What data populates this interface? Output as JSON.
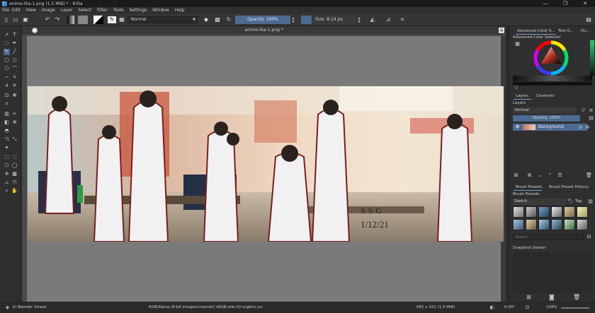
{
  "window": {
    "title": "anime-tka-1.png (1.5 MiB)  * - Krita",
    "minimize": "—",
    "maximize": "❐",
    "close": "✕"
  },
  "menu": [
    "File",
    "Edit",
    "View",
    "Image",
    "Layer",
    "Select",
    "Filter",
    "Tools",
    "Settings",
    "Window",
    "Help"
  ],
  "toolbar": {
    "blend_mode": "Normal",
    "opacity": "Opacity: 100%",
    "size": "Size: 8.14 px"
  },
  "document": {
    "tab_title": "anime-tka-1.png *",
    "signature": "S·S·G",
    "signature_date": "1/12/21"
  },
  "dockers": {
    "top_tabs": [
      "Advanced Color S...",
      "Tool O...",
      "Ov..."
    ],
    "color_selector_title": "Advanced Color Selector",
    "layers_tabs": [
      "Layers",
      "Channels"
    ],
    "layers_section": "Layers",
    "layer_blend": "Normal",
    "layer_opacity": "Opacity: 100%",
    "layer_name": "Background",
    "brush_tabs": [
      "Brush Presets",
      "Brush Preset History"
    ],
    "brush_presets_title": "Brush Presets",
    "brush_tag": "Sketch",
    "tag_label": "Tag",
    "search_placeholder": "Search",
    "snapshot_title": "Snapshot Docker"
  },
  "status": {
    "brush": "k) Blender Smear",
    "color_info": "RGB/Alpha (8-bit integer/channel)  sRGB-elle-V2-srgbtrc.icc",
    "dimensions": "681 x 321 (1.5 MiB)",
    "rotation": "0.00°",
    "zoom": "158%"
  },
  "colors": {
    "accent": "#4c6a92",
    "background": "#2b2b2b",
    "panel": "#2f2f2f",
    "canvas": "#7a7a7a"
  }
}
